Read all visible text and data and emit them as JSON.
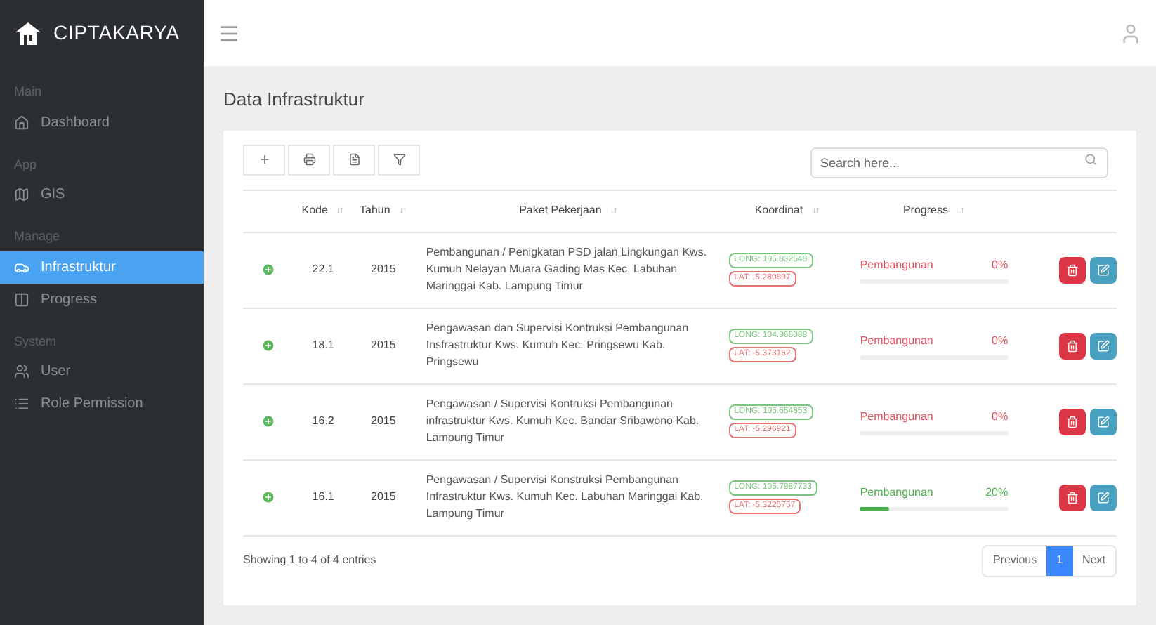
{
  "brand": "CIPTAKARYA",
  "sidebar": {
    "sections": [
      {
        "heading": "Main",
        "items": [
          {
            "label": "Dashboard",
            "selected": false
          }
        ]
      },
      {
        "heading": "App",
        "items": [
          {
            "label": "GIS",
            "selected": false
          }
        ]
      },
      {
        "heading": "Manage",
        "items": [
          {
            "label": "Infrastruktur",
            "selected": true
          },
          {
            "label": "Progress",
            "selected": false
          }
        ]
      },
      {
        "heading": "System",
        "items": [
          {
            "label": "User",
            "selected": false
          },
          {
            "label": "Role Permission",
            "selected": false
          }
        ]
      }
    ]
  },
  "page_title": "Data Infrastruktur",
  "search": {
    "placeholder": "Search here..."
  },
  "table": {
    "columns": [
      {
        "label": "Kode"
      },
      {
        "label": "Tahun"
      },
      {
        "label": "Paket Pekerjaan"
      },
      {
        "label": "Koordinat"
      },
      {
        "label": "Progress"
      }
    ],
    "rows": [
      {
        "kode": "22.1",
        "tahun": "2015",
        "paket": "Pembangunan / Penigkatan PSD jalan Lingkungan Kws. Kumuh Nelayan Muara Gading Mas Kec. Labuhan Maringgai Kab. Lampung Timur",
        "long": "LONG: 105.832548",
        "lat": "LAT: -5.280897",
        "progress_label": "Pembangunan",
        "percent": "0%",
        "level": 0,
        "color": "#e0505e"
      },
      {
        "kode": "18.1",
        "tahun": "2015",
        "paket": "Pengawasan dan Supervisi Kontruksi Pembangunan Insfrastruktur Kws. Kumuh Kec. Pringsewu Kab. Pringsewu",
        "long": "LONG: 104.966088",
        "lat": "LAT: -5.373162",
        "progress_label": "Pembangunan",
        "percent": "0%",
        "level": 0,
        "color": "#e0505e"
      },
      {
        "kode": "16.2",
        "tahun": "2015",
        "paket": "Pengawasan / Supervisi Kontruksi Pembangunan infrastruktur Kws. Kumuh Kec. Bandar Sribawono Kab. Lampung Timur",
        "long": "LONG: 105.654853",
        "lat": "LAT: -5.296921",
        "progress_label": "Pembangunan",
        "percent": "0%",
        "level": 0,
        "color": "#e0505e"
      },
      {
        "kode": "16.1",
        "tahun": "2015",
        "paket": "Pengawasan / Supervisi Konstruksi Pembangunan Infrastruktur Kws. Kumuh Kec. Labuhan Maringgai Kab. Lampung Timur",
        "long": "LONG: 105.7987733",
        "lat": "LAT: -5.3225757",
        "progress_label": "Pembangunan",
        "percent": "20%",
        "level": 0.2,
        "color": "#4caf50"
      }
    ]
  },
  "footer_info": "Showing 1 to 4 of 4 entries",
  "pagination": [
    {
      "label": "Previous",
      "selected": false
    },
    {
      "label": "1",
      "selected": true
    },
    {
      "label": "Next",
      "selected": false
    }
  ]
}
